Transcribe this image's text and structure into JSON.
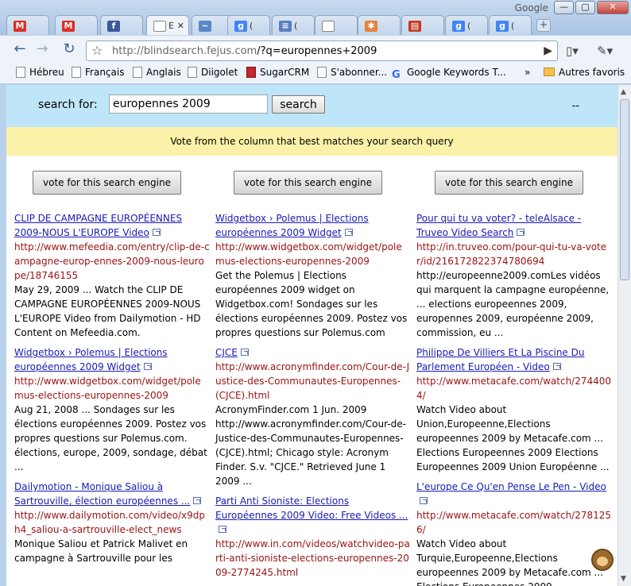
{
  "browser": {
    "google_label": "Google",
    "window_buttons": {
      "minimize": "—",
      "maximize": "▢",
      "close": "✕"
    },
    "tabs": [
      {
        "icon": "gmail-icon",
        "title": "",
        "color": "#d93025",
        "glyph": "M"
      },
      {
        "icon": "gmail-icon",
        "title": "",
        "color": "#d93025",
        "glyph": "M"
      },
      {
        "icon": "facebook-icon",
        "title": "",
        "color": "#3b5998",
        "glyph": "f"
      },
      {
        "icon": "page-icon",
        "title": "E",
        "active": true,
        "color": "#ffffff",
        "glyph": ""
      },
      {
        "icon": "chart-icon",
        "title": "",
        "color": "#5b87c5",
        "glyph": "~"
      },
      {
        "icon": "google-icon",
        "title": "(",
        "color": "#4285f4",
        "glyph": "g"
      },
      {
        "icon": "rss-icon",
        "title": "(",
        "color": "#5a7fc0",
        "glyph": "≡"
      },
      {
        "icon": "page-icon",
        "title": "",
        "color": "#ffffff",
        "glyph": ""
      },
      {
        "icon": "pinwheel-icon",
        "title": "",
        "color": "#e7823a",
        "glyph": "✱"
      },
      {
        "icon": "calendar-icon",
        "title": "",
        "color": "#c23b22",
        "glyph": "▤"
      },
      {
        "icon": "google-icon",
        "title": "(",
        "color": "#4285f4",
        "glyph": "g"
      },
      {
        "icon": "google-icon",
        "title": "(",
        "color": "#4285f4",
        "glyph": "g"
      }
    ],
    "url_host": "http://blindsearch.fejus.com",
    "url_path": "/?q=europennes+2009",
    "bookmarks": [
      {
        "label": "Hébreu",
        "icon": "page-icon"
      },
      {
        "label": "Français",
        "icon": "page-icon"
      },
      {
        "label": "Anglais",
        "icon": "page-icon"
      },
      {
        "label": "Diigolet",
        "icon": "page-icon"
      },
      {
        "label": "SugarCRM",
        "icon": "sugarcrm-icon"
      },
      {
        "label": "S'abonner...",
        "icon": "page-icon"
      },
      {
        "label": "Google Keywords T...",
        "icon": "google-icon"
      },
      {
        "label": "»",
        "icon": ""
      },
      {
        "label": "Autres favoris",
        "icon": "folder-icon"
      }
    ]
  },
  "page": {
    "search_label": "search for:",
    "search_value": "europennes 2009",
    "search_button": "search",
    "dashes": "--",
    "vote_banner": "Vote from the column that best matches your search query",
    "vote_button_label": "vote for this search engine",
    "columns": [
      [
        {
          "title": "CLIP DE CAMPAGNE EUROPÉENNES 2009-NOUS L'EUROPE Video",
          "url": "http://www.mefeedia.com/entry/clip-de-campagne-europ-ennes-2009-nous-leurope/18746155",
          "snippet": "May 29, 2009 ... Watch the CLIP DE CAMPAGNE EUROPÉENNES 2009-NOUS L'EUROPE Video from Dailymotion - HD Content on Mefeedia.com."
        },
        {
          "title": "Widgetbox › Polemus | Elections européennes 2009 Widget",
          "url": "http://www.widgetbox.com/widget/polemus-elections-europennes-2009",
          "snippet": "Aug 21, 2008 ... Sondages sur les élections européennes 2009. Postez vos propres questions sur Polemus.com. élections, europe, 2009, sondage, débat ..."
        },
        {
          "title": "Dailymotion - Monique Saliou à Sartrouville, élection européennes ...",
          "url": "http://www.dailymotion.com/video/x9dph4_saliou-a-sartrouville-elect_news",
          "snippet": "Monique Saliou et Patrick Malivet en campagne à Sartrouville pour les"
        }
      ],
      [
        {
          "title": "Widgetbox › Polemus | Elections européennes 2009 Widget",
          "url": "http://www.widgetbox.com/widget/polemus-elections-europennes-2009",
          "snippet": "Get the Polemus | Elections européennes 2009 widget on Widgetbox.com! Sondages sur les élections européennes 2009. Postez vos propres questions sur Polemus.com"
        },
        {
          "title": "CJCE",
          "url": "http://www.acronymfinder.com/Cour-de-Justice-des-Communautes-Europennes-(CJCE).html",
          "snippet": "AcronymFinder.com 1 Jun. 2009 http://www.acronymfinder.com/Cour-de-Justice-des-Communautes-Europennes-(CJCE).html; Chicago style: Acronym Finder. S.v. \"CJCE.\" Retrieved June 1 2009 ..."
        },
        {
          "title": "Parti Anti Sioniste: Elections Européennes 2009 Video: Free Videos ...",
          "url": "http://www.in.com/videos/watchvideo-parti-anti-sioniste-elections-europennes-2009-2774245.html",
          "snippet": ""
        }
      ],
      [
        {
          "title": "Pour qui tu va voter? - teleAlsace - Truveo Video Search",
          "url": "http://in.truveo.com/pour-qui-tu-va-voter/id/216172822374780694",
          "snippet": "http://europeenne2009.comLes vidéos qui marquent la campagne européenne, ... elections europeennes 2009, europennes 2009, européenne 2009, commission, eu ..."
        },
        {
          "title": "Philippe De Villiers Et La Piscine Du Parlement Européen - Video",
          "url": "http://www.metacafe.com/watch/2744004/",
          "snippet": "Watch Video about Union,Europeenne,Elections europeennes 2009 by Metacafe.com ... Elections Europeennes 2009 Elections Europeennes 2009 Union Européenne ..."
        },
        {
          "title": "L'europe Ce Qu'en Pense Le Pen - Video",
          "url": "http://www.metacafe.com/watch/2781256/",
          "snippet": "Watch Video about Turquie,Europeenne,Elections europeennes 2009 by Metacafe.com ... Elections Europeennes 2009"
        }
      ]
    ]
  }
}
